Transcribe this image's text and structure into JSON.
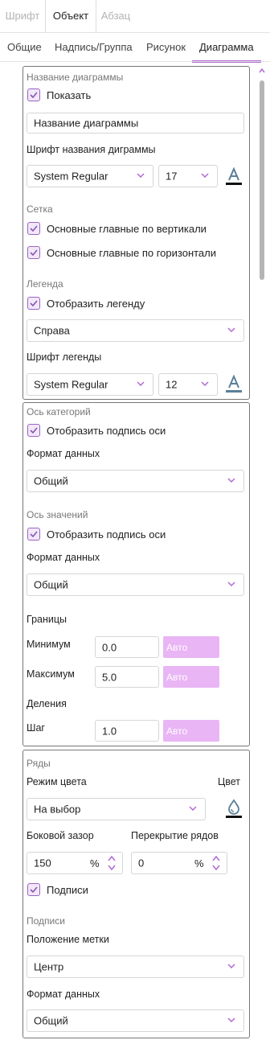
{
  "top_tabs": {
    "font": "Шрифт",
    "object": "Объект",
    "paragraph": "Абзац"
  },
  "sub_tabs": {
    "general": "Общие",
    "caption": "Надпись/Группа",
    "picture": "Рисунок",
    "chart": "Диаграмма"
  },
  "title_section": {
    "header": "Название диаграммы",
    "show_label": "Показать",
    "show_checked": true,
    "title_value": "Название диаграммы",
    "font_label": "Шрифт названия диграммы",
    "font_family": "System Regular",
    "font_size": "17"
  },
  "grid_section": {
    "header": "Сетка",
    "vertical_label": "Основные главные по вертикали",
    "horizontal_label": "Основные главные по горизонтали"
  },
  "legend_section": {
    "header": "Легенда",
    "show_label": "Отобразить легенду",
    "position": "Справа",
    "font_label": "Шрифт легенды",
    "font_family": "System Regular",
    "font_size": "12"
  },
  "category_axis": {
    "header": "Ось категорий",
    "show_label": "Отобразить подпись оси",
    "format_label": "Формат данных",
    "format_value": "Общий"
  },
  "value_axis": {
    "header": "Ось значений",
    "show_label": "Отобразить подпись оси",
    "format_label": "Формат данных",
    "format_value": "Общий",
    "bounds_label": "Границы",
    "min_label": "Минимум",
    "min_value": "0.0",
    "max_label": "Максимум",
    "max_value": "5.0",
    "ticks_label": "Деления",
    "step_label": "Шаг",
    "step_value": "1.0",
    "auto_label": "Авто"
  },
  "series_section": {
    "header": "Ряды",
    "color_mode_label": "Режим цвета",
    "color_label": "Цвет",
    "color_mode_value": "На выбор",
    "gap_label": "Боковой зазор",
    "gap_value": "150",
    "overlap_label": "Перекрытие рядов",
    "overlap_value": "0",
    "percent": "%",
    "labels_checkbox": "Подписи"
  },
  "labels_section": {
    "header": "Подписи",
    "position_label": "Положение метки",
    "position_value": "Центр",
    "format_label": "Формат данных",
    "format_value": "Общий"
  },
  "colors": {
    "accent": "#b06bd6",
    "checkbox_border": "#9a63c5",
    "auto_button": "#e9b5f5",
    "panel_border": "#777777"
  }
}
